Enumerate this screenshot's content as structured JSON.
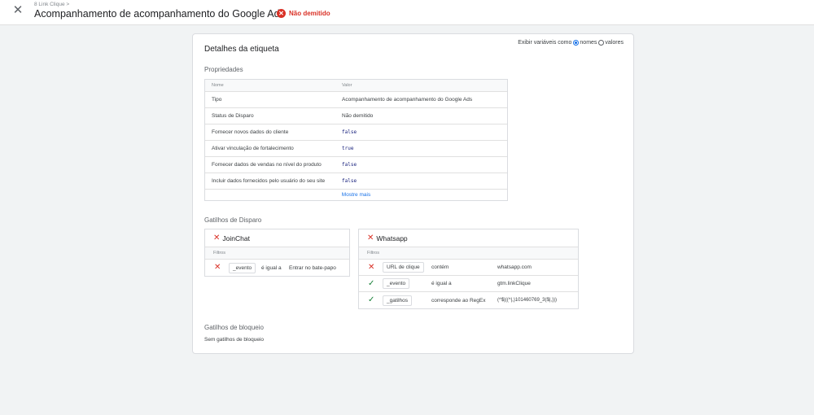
{
  "header": {
    "close_icon": "close-icon",
    "breadcrumb": "8 Link Clique >",
    "title": "Acompanhamento de acompanhamento do Google Ads",
    "status": "Não demitido",
    "status_color": "#d93025"
  },
  "card": {
    "title": "Detalhes da etiqueta",
    "toggle": {
      "label": "Exibir variáveis como",
      "option1": "nomes",
      "option2": "valores",
      "selected": "nomes"
    },
    "properties_title": "Propriedades",
    "properties_header": {
      "name": "Nome",
      "value": "Valor"
    },
    "properties": [
      {
        "name": "Tipo",
        "value": "Acompanhamento de acompanhamento do Google Ads"
      },
      {
        "name": "Status de Disparo",
        "value": "Não demitido"
      },
      {
        "name": "Fornecer novos dados do cliente",
        "value": "false"
      },
      {
        "name": "Ativar vinculação de fortalecimento",
        "value": "true"
      },
      {
        "name": "Fornecer dados de vendas no nível do produto",
        "value": "false"
      },
      {
        "name": "Incluir dados fornecidos pelo usuário do seu site",
        "value": "false"
      }
    ],
    "show_more": "Mostre mais",
    "triggers_title": "Gatilhos de Disparo",
    "filters_label": "Filtros",
    "triggers": [
      {
        "name": "JoinChat",
        "filters": [
          {
            "variable": "_evento",
            "operator": "é igual a",
            "value": "Entrar no bate-papo",
            "matched": false
          }
        ]
      },
      {
        "name": "Whatsapp",
        "filters": [
          {
            "variable": "URL de clique",
            "operator": "contém",
            "value": "whatsapp.com",
            "matched": false
          },
          {
            "variable": "_evento",
            "operator": "é igual a",
            "value": "gtm.linkClique",
            "matched": true
          },
          {
            "variable": "_gatilhos",
            "operator": "corresponde ao RegEx",
            "value": "(^$|((^|,)101460769_3($|,)))",
            "matched": true
          }
        ]
      }
    ],
    "blocking_title": "Gatilhos de bloqueio",
    "blocking_none": "Sem gatilhos de bloqueio"
  }
}
